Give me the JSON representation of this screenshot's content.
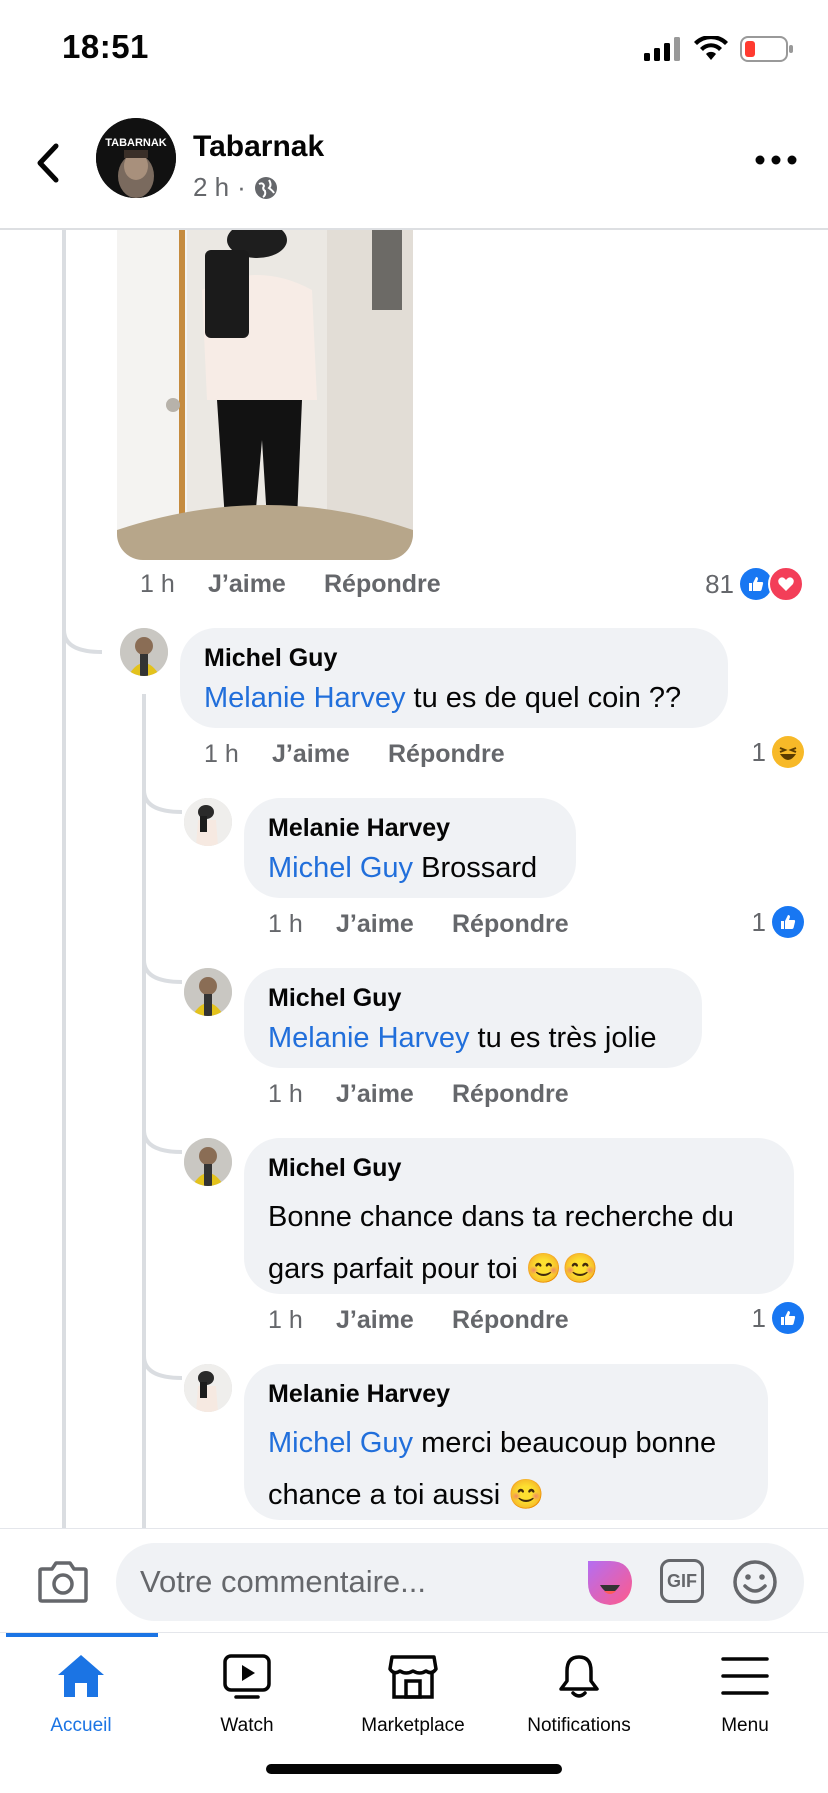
{
  "status_bar": {
    "time": "18:51"
  },
  "header": {
    "page_name": "Tabarnak",
    "time_ago": "2 h",
    "separator": "·",
    "avatar_text": "TABARNAK"
  },
  "photo_comment": {
    "time": "1 h",
    "like_label": "J’aime",
    "reply_label": "Répondre",
    "reaction_count": "81"
  },
  "comments": [
    {
      "author": "Michel Guy",
      "mention": "Melanie Harvey",
      "text": " tu es de quel coin ??",
      "time": "1 h",
      "like_label": "J’aime",
      "reply_label": "Répondre",
      "reaction_count": "1"
    },
    {
      "author": "Melanie Harvey",
      "mention": "Michel Guy",
      "text": " Brossard",
      "time": "1 h",
      "like_label": "J’aime",
      "reply_label": "Répondre",
      "reaction_count": "1"
    },
    {
      "author": "Michel Guy",
      "mention": "Melanie Harvey",
      "text": " tu es très jolie",
      "time": "1 h",
      "like_label": "J’aime",
      "reply_label": "Répondre"
    },
    {
      "author": "Michel Guy",
      "text_line1": "Bonne chance dans ta recherche  du",
      "text_line2": "gars parfait pour toi 😊😊",
      "time": "1 h",
      "like_label": "J’aime",
      "reply_label": "Répondre",
      "reaction_count": "1"
    },
    {
      "author": "Melanie Harvey",
      "mention": "Michel Guy",
      "text_line1": " merci beaucoup bonne",
      "text_line2": "chance a toi aussi 😊"
    }
  ],
  "composer": {
    "placeholder": "Votre commentaire...",
    "gif_label": "GIF"
  },
  "nav": {
    "home": "Accueil",
    "watch": "Watch",
    "marketplace": "Marketplace",
    "notifications": "Notifications",
    "menu": "Menu"
  },
  "colors": {
    "accent": "#1b74e4",
    "mention": "#216fdb",
    "bubble": "#f0f2f5",
    "like_blue": "#1877f2",
    "love_red": "#f33e58"
  }
}
